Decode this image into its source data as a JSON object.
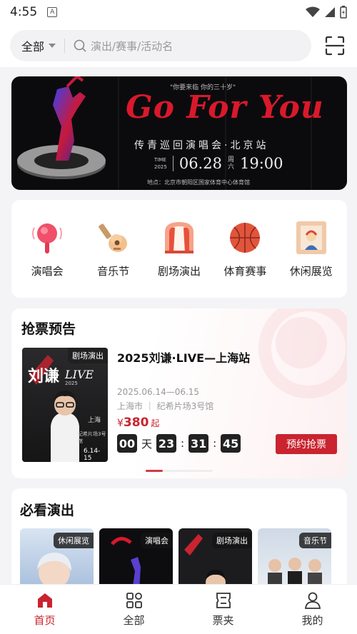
{
  "status_bar": {
    "time": "4:55",
    "notif_letter": "A"
  },
  "search": {
    "filter_label": "全部",
    "placeholder": "演出/赛事/活动名"
  },
  "banner": {
    "top_tag": "\"你要来临 你的三十岁\"",
    "title": "Go For You",
    "subtitle": "传青巡回演唱会·北京站",
    "year_top": "TIME",
    "year": "2025",
    "date": "06.28",
    "weekday_top": "周",
    "weekday": "六",
    "time": "19:00",
    "venue": "地点：北京市朝阳区国家体育中心体育馆"
  },
  "categories": [
    {
      "label": "演唱会",
      "icon": "concert-icon"
    },
    {
      "label": "音乐节",
      "icon": "guitar-icon"
    },
    {
      "label": "剧场演出",
      "icon": "theater-icon"
    },
    {
      "label": "体育赛事",
      "icon": "basketball-icon"
    },
    {
      "label": "休闲展览",
      "icon": "painting-icon"
    }
  ],
  "presale": {
    "title": "抢票预告",
    "poster_tag": "剧场演出",
    "poster_name": "刘谦",
    "poster_live": "LIVE",
    "poster_year": "2025",
    "poster_city": "上海",
    "poster_venue": "纪希片场3号馆",
    "poster_date": "6.14-15",
    "event_name": "2025刘谦·LIVE—上海站",
    "date": "2025.06.14—06.15",
    "venue": "上海市 ｜ 纪希片场3号馆",
    "currency": "¥",
    "price": "380",
    "price_suffix": "起",
    "countdown": {
      "days": "00",
      "days_label": "天",
      "hours": "23",
      "minutes": "31",
      "seconds": "45"
    },
    "button": "预约抢票",
    "accent": "#c9242f"
  },
  "must_see": {
    "title": "必看演出",
    "items": [
      {
        "tag": "休闲展览"
      },
      {
        "tag": "演唱会"
      },
      {
        "tag": "剧场演出"
      },
      {
        "tag": "音乐节"
      }
    ]
  },
  "tabs": [
    {
      "label": "首页",
      "icon": "home-icon",
      "active": true
    },
    {
      "label": "全部",
      "icon": "grid-icon",
      "active": false
    },
    {
      "label": "票夹",
      "icon": "ticket-icon",
      "active": false
    },
    {
      "label": "我的",
      "icon": "user-icon",
      "active": false
    }
  ]
}
